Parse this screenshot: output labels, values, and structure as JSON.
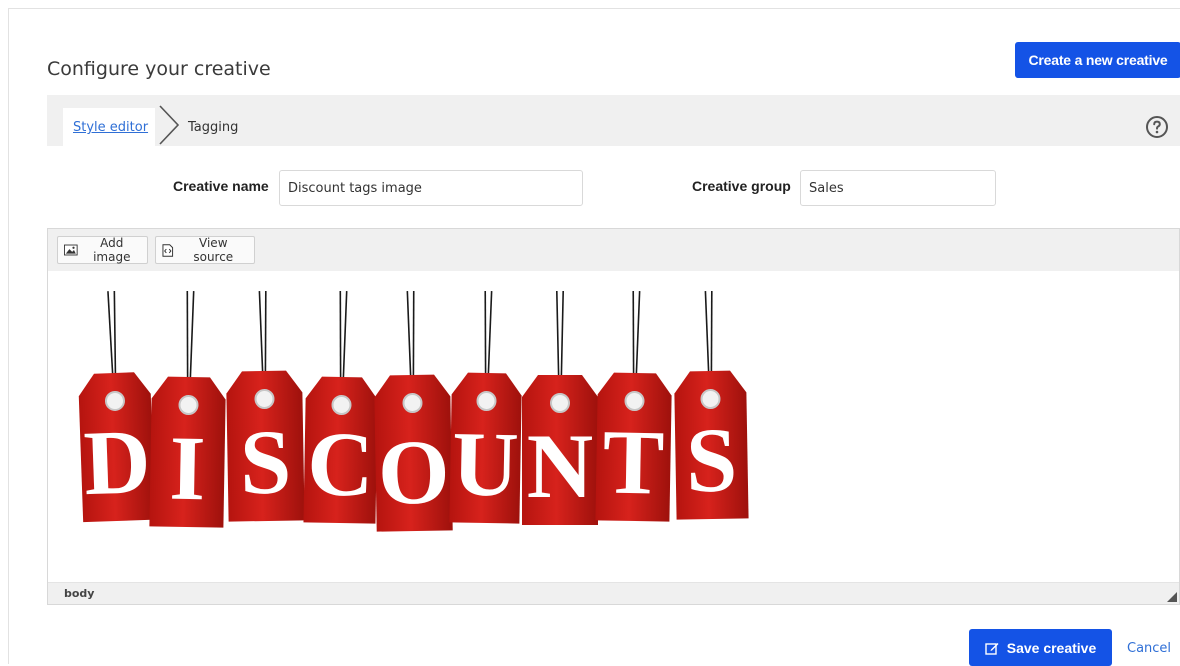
{
  "header": {
    "title": "Configure your creative",
    "create_button_label": "Create a new creative"
  },
  "tabs": [
    {
      "label": "Style editor",
      "active": true
    },
    {
      "label": "Tagging",
      "active": false
    }
  ],
  "help_icon": "help-circle-icon",
  "form": {
    "creative_name_label": "Creative name",
    "creative_name_value": "Discount tags image",
    "creative_group_label": "Creative group",
    "creative_group_value": "Sales"
  },
  "editor": {
    "toolbar": {
      "add_image_label": "Add image",
      "view_source_label": "View source"
    },
    "status_path": "body",
    "image": {
      "letters": [
        "D",
        "I",
        "S",
        "C",
        "O",
        "U",
        "N",
        "T",
        "S"
      ],
      "tag_color": "#d7221c"
    }
  },
  "footer": {
    "save_label": "Save creative",
    "cancel_label": "Cancel"
  },
  "colors": {
    "primary": "#1453e6",
    "link": "#2f6fd6"
  }
}
